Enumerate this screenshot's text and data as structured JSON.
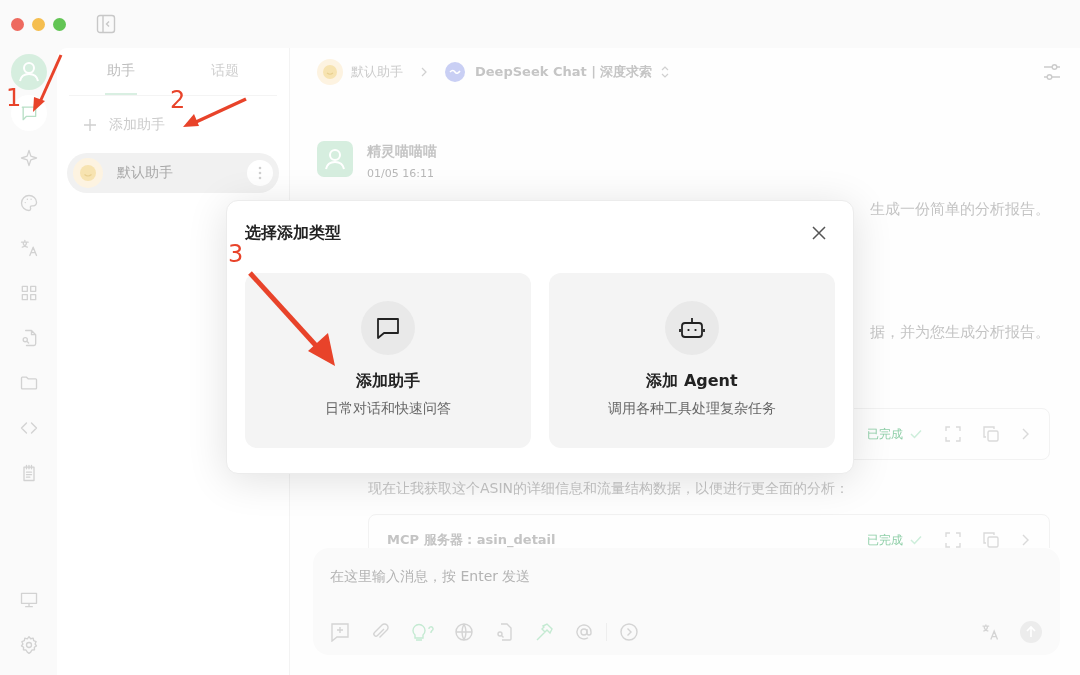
{
  "sidebar": {
    "top_items": [
      {
        "kind": "chat",
        "selected": true
      },
      {
        "kind": "sparkle",
        "selected": false
      },
      {
        "kind": "palette",
        "selected": false
      },
      {
        "kind": "translate",
        "selected": false
      },
      {
        "kind": "grid",
        "selected": false
      },
      {
        "kind": "doc-search",
        "selected": false
      },
      {
        "kind": "folder",
        "selected": false
      },
      {
        "kind": "code",
        "selected": false
      },
      {
        "kind": "notepad",
        "selected": false
      }
    ],
    "bottom_items": [
      {
        "kind": "monitor",
        "selected": false
      },
      {
        "kind": "settings",
        "selected": false
      }
    ]
  },
  "assistant_panel": {
    "tabs": [
      {
        "label": "助手",
        "selected": true
      },
      {
        "label": "话题",
        "selected": false
      }
    ],
    "add_button": "添加助手",
    "assistants": [
      {
        "name": "默认助手",
        "selected": true
      }
    ]
  },
  "header": {
    "assistant": "默认助手",
    "model": "DeepSeek Chat | 深度求索"
  },
  "message": {
    "author": "精灵喵喵喵",
    "time": "01/05 16:11",
    "visible_fragments": [
      "生成一份简单的分析报告。",
      "据，并为您生成分析报告。"
    ],
    "tool_calls": [
      {
        "status": "已完成"
      },
      {
        "title": "MCP 服务器 : asin_detail",
        "status": "已完成"
      }
    ],
    "text": "现在让我获取这个ASIN的详细信息和流量结构数据，以便进行更全面的分析："
  },
  "composer": {
    "placeholder": "在这里输入消息，按 Enter 发送"
  },
  "dialog": {
    "title": "选择添加类型",
    "options": [
      {
        "kind": "assistant",
        "title": "添加助手",
        "description": "日常对话和快速问答"
      },
      {
        "kind": "agent",
        "title": "添加 Agent",
        "description": "调用各种工具处理复杂任务"
      }
    ]
  },
  "annotations": [
    "1",
    "2",
    "3"
  ]
}
